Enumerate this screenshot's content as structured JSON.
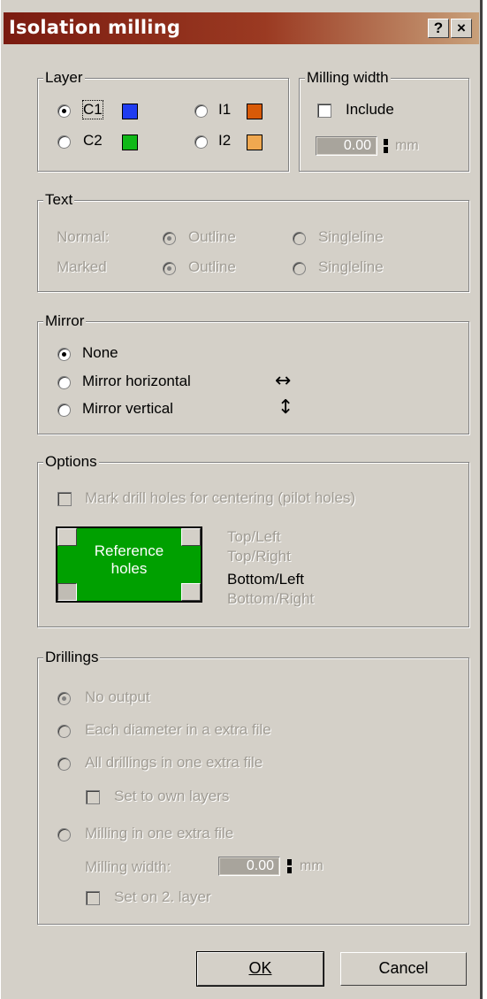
{
  "window": {
    "title": "Isolation milling",
    "help_label": "?",
    "close_label": "×"
  },
  "layer": {
    "legend": "Layer",
    "options": [
      {
        "label": "C1",
        "color": "#1f3cf0",
        "selected": true
      },
      {
        "label": "I1",
        "color": "#d85a08",
        "selected": false
      },
      {
        "label": "C2",
        "color": "#10b818",
        "selected": false
      },
      {
        "label": "I2",
        "color": "#f0a850",
        "selected": false
      }
    ]
  },
  "milling_width": {
    "legend": "Milling width",
    "include_label": "Include",
    "value": "0.00",
    "unit": "mm"
  },
  "text": {
    "legend": "Text",
    "rows": [
      {
        "label": "Normal:",
        "opt1": "Outline",
        "opt2": "Singleline"
      },
      {
        "label": "Marked",
        "opt1": "Outline",
        "opt2": "Singleline"
      }
    ]
  },
  "mirror": {
    "legend": "Mirror",
    "options": [
      {
        "label": "None",
        "selected": true,
        "icon": ""
      },
      {
        "label": "Mirror horizontal",
        "selected": false,
        "icon": "↔"
      },
      {
        "label": "Mirror vertical",
        "selected": false,
        "icon": "↕"
      }
    ]
  },
  "options": {
    "legend": "Options",
    "mark_drill_label": "Mark drill holes for centering (pilot holes)",
    "ref_line1": "Reference",
    "ref_line2": "holes",
    "corners": [
      "Top/Left",
      "Top/Right",
      "Bottom/Left",
      "Bottom/Right"
    ],
    "active_corner": "Bottom/Left"
  },
  "drillings": {
    "legend": "Drillings",
    "no_output": "No output",
    "each_diameter": "Each diameter in a extra file",
    "all_drillings": "All drillings in one extra file",
    "set_own_layers": "Set to own layers",
    "milling_one": "Milling in one extra file",
    "milling_width_label": "Milling width:",
    "milling_width_value": "0.00",
    "unit": "mm",
    "set_on_2": "Set on 2. layer"
  },
  "buttons": {
    "ok": "OK",
    "cancel": "Cancel"
  }
}
